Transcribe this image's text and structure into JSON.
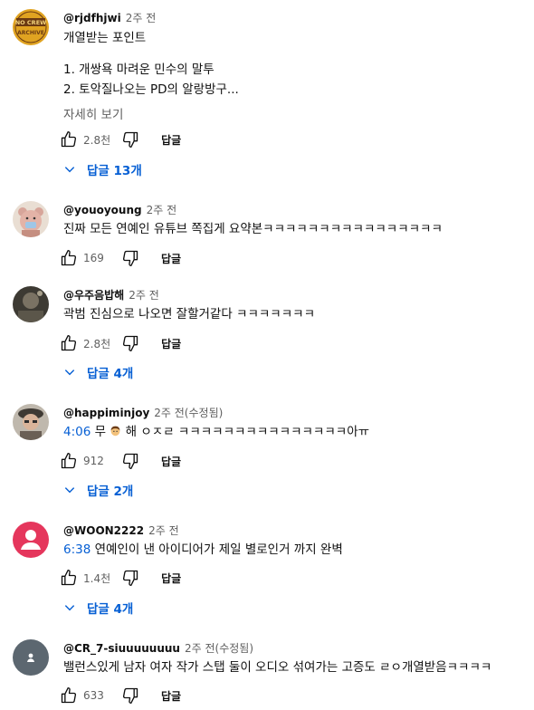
{
  "labels": {
    "reply": "답글"
  },
  "comments": [
    {
      "author": "@rjdfhjwi",
      "meta": "2주 전",
      "avatar_text": [
        "NO CREW",
        "ARCHIVE"
      ],
      "lines": [
        "개열받는 포인트",
        "",
        "1. 개쌍욕 마려운 민수의 말투",
        "2. 토악질나오는 PD의 알랑방구..."
      ],
      "more": "자세히 보기",
      "likes": "2.8천",
      "replies": "답글 13개"
    },
    {
      "author": "@youoyoung",
      "meta": "2주 전",
      "text": "진짜 모든 연예인 유튜브 쪽집게 요약본ㅋㅋㅋㅋㅋㅋㅋㅋㅋㅋㅋㅋㅋㅋㅋㅋ",
      "likes": "169"
    },
    {
      "author": "@우주음밥해",
      "meta": "2주 전",
      "text": "곽범 진심으로 나오면 잘할거같다 ㅋㅋㅋㅋㅋㅋㅋ",
      "likes": "2.8천",
      "replies": "답글 4개"
    },
    {
      "author": "@happiminjoy",
      "meta": "2주 전(수정됨)",
      "timestamp": "4:06",
      "text_before": " 무 ",
      "text_after": " 해 ㅇㅈㄹ ㅋㅋㅋㅋㅋㅋㅋㅋㅋㅋㅋㅋㅋㅋㅋ아ㅠ",
      "likes": "912",
      "replies": "답글 2개"
    },
    {
      "author": "@WOON2222",
      "meta": "2주 전",
      "timestamp": "6:38",
      "text": " 연예인이 낸 아이디어가 제일 별로인거 까지 완벽",
      "likes": "1.4천",
      "replies": "답글 4개"
    },
    {
      "author": "@CR_7-siuuuuuuuu",
      "meta": "2주 전(수정됨)",
      "text": "밸런스있게 남자 여자 작가 스탭 둘이 오디오 섞여가는 고증도 ㄹㅇ개열받음ㅋㅋㅋㅋ",
      "likes": "633"
    }
  ]
}
